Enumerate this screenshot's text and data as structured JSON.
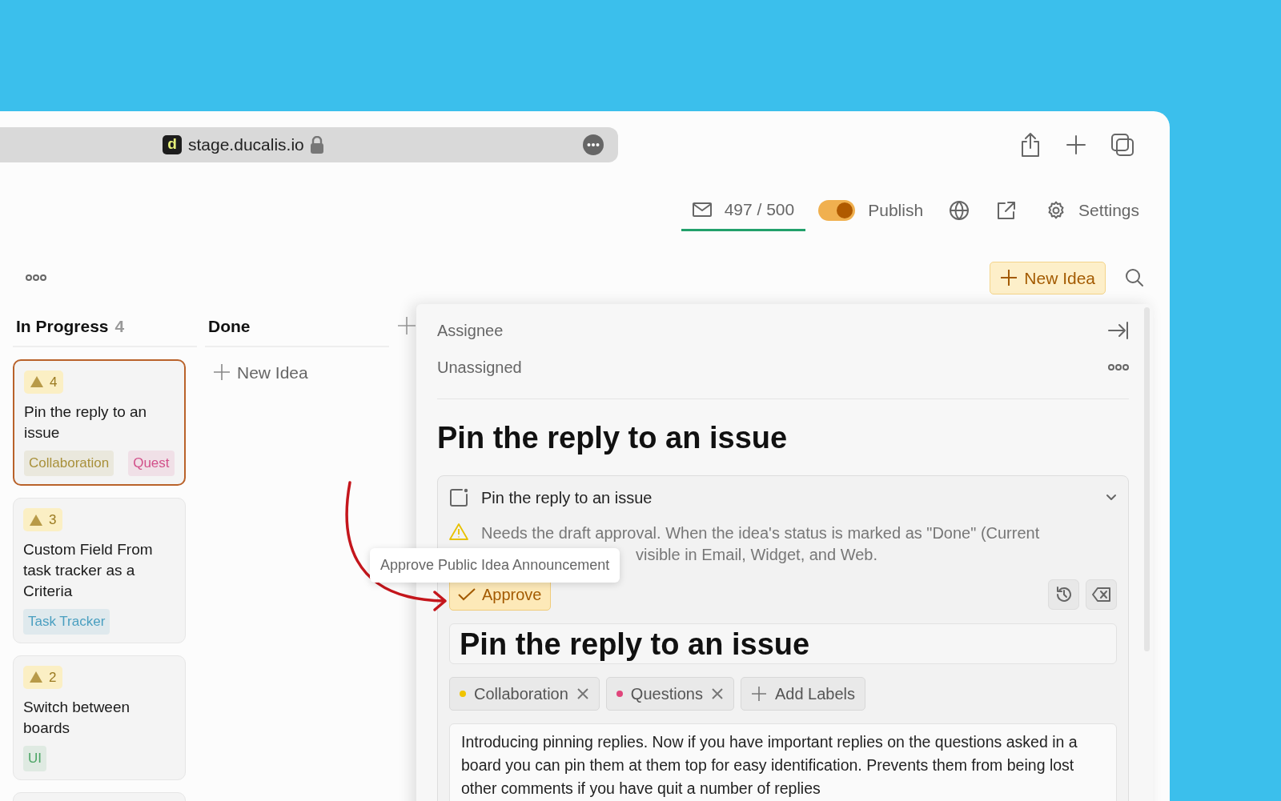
{
  "browser": {
    "favicon": "d",
    "url": "stage.ducalis.io"
  },
  "header": {
    "email_count": "497 / 500",
    "email_selected": true,
    "publish": {
      "label": "Publish",
      "on": true
    },
    "settings": "Settings"
  },
  "toolbar": {
    "new_idea": "New Idea"
  },
  "columns": [
    {
      "title": "In Progress",
      "count": "4",
      "cards": [
        {
          "kind": "card",
          "votes": "4",
          "title": "Pin the reply to an issue",
          "selected": true,
          "labels": [
            {
              "text": "Collaboration",
              "color": "#a8903a"
            },
            {
              "text": "Quest",
              "color": "#d2508a"
            }
          ]
        },
        {
          "kind": "card",
          "votes": "3",
          "title": "Custom Field From task tracker as a Criteria",
          "selected": false,
          "labels": [
            {
              "text": "Task Tracker",
              "color": "#4a9fc0"
            }
          ]
        },
        {
          "kind": "card",
          "votes": "2",
          "title": "Switch between boards",
          "selected": false,
          "labels": [
            {
              "text": "UI",
              "color": "#4aa464"
            }
          ]
        },
        {
          "kind": "partial"
        }
      ]
    },
    {
      "title": "Done",
      "new_idea": "New Idea"
    }
  ],
  "detail": {
    "assignee_label": "Assignee",
    "assignee": "Unassigned",
    "title": "Pin the reply to an issue",
    "draft": {
      "heading": "Pin the reply to an issue",
      "expanded": true,
      "warning_line_1": "Needs the draft approval. When the idea's status is marked as \"Done\" (Current",
      "warning_line_2": "visible in Email, Widget, and Web.",
      "approve": "Approve",
      "title": "Pin the reply to an issue",
      "labels": [
        {
          "text": "Collaboration",
          "color": "#f0c400"
        },
        {
          "text": "Questions",
          "color": "#e0457b"
        }
      ],
      "add_labels": "Add Labels",
      "body": "Introducing pinning replies. Now if you have important replies on the questions asked in a board you can pin them at them top for easy identification. Prevents them from being lost other comments if you have quit a number of replies"
    }
  },
  "tooltip": "Approve Public Idea Announcement"
}
